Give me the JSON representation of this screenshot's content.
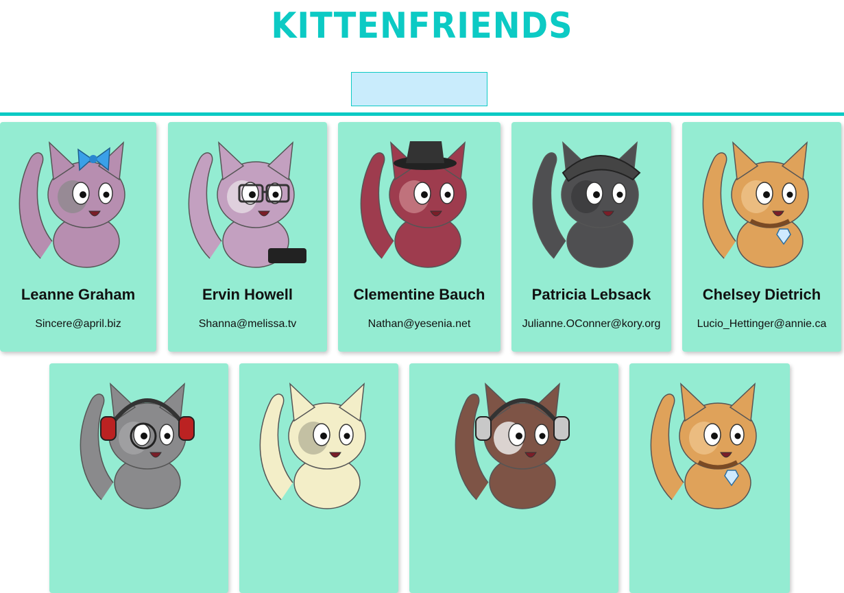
{
  "app": {
    "title": "KITTENFRIENDS"
  },
  "search": {
    "placeholder": "",
    "value": ""
  },
  "colors": {
    "accent": "#0ccac4",
    "card": "#94ecd2",
    "search_bg": "#c9ecfc"
  },
  "cards": [
    {
      "name": "Leanne Graham",
      "email": "Sincere@april.biz",
      "fur": "#b78eb0",
      "patch": "#8f8a8e",
      "accessory": "blue-bow"
    },
    {
      "name": "Ervin Howell",
      "email": "Shanna@melissa.tv",
      "fur": "#c3a0c0",
      "patch": "#e6dce3",
      "accessory": "glasses-typewriter"
    },
    {
      "name": "Clementine Bauch",
      "email": "Nathan@yesenia.net",
      "fur": "#9e3c4e",
      "patch": "#c87f88",
      "accessory": "fedora-hat"
    },
    {
      "name": "Patricia Lebsack",
      "email": "Julianne.OConner@kory.org",
      "fur": "#4f4f51",
      "patch": "#3a3a3c",
      "accessory": "bandana"
    },
    {
      "name": "Chelsey Dietrich",
      "email": "Lucio_Hettinger@annie.ca",
      "fur": "#dfa25a",
      "patch": "#eec38a",
      "accessory": "diamond-collar"
    },
    {
      "name": "",
      "email": "",
      "fur": "#8a8a8c",
      "patch": "#a4a4a6",
      "accessory": "headphones-monocle"
    },
    {
      "name": "",
      "email": "",
      "fur": "#f3eec8",
      "patch": "#b6b49a",
      "accessory": "none"
    },
    {
      "name": "",
      "email": "",
      "fur": "#7e5446",
      "patch": "#f2f2f2",
      "accessory": "headphones"
    },
    {
      "name": "",
      "email": "",
      "fur": "#dfa25a",
      "patch": "#eec38a",
      "accessory": "diamond-collar"
    }
  ]
}
